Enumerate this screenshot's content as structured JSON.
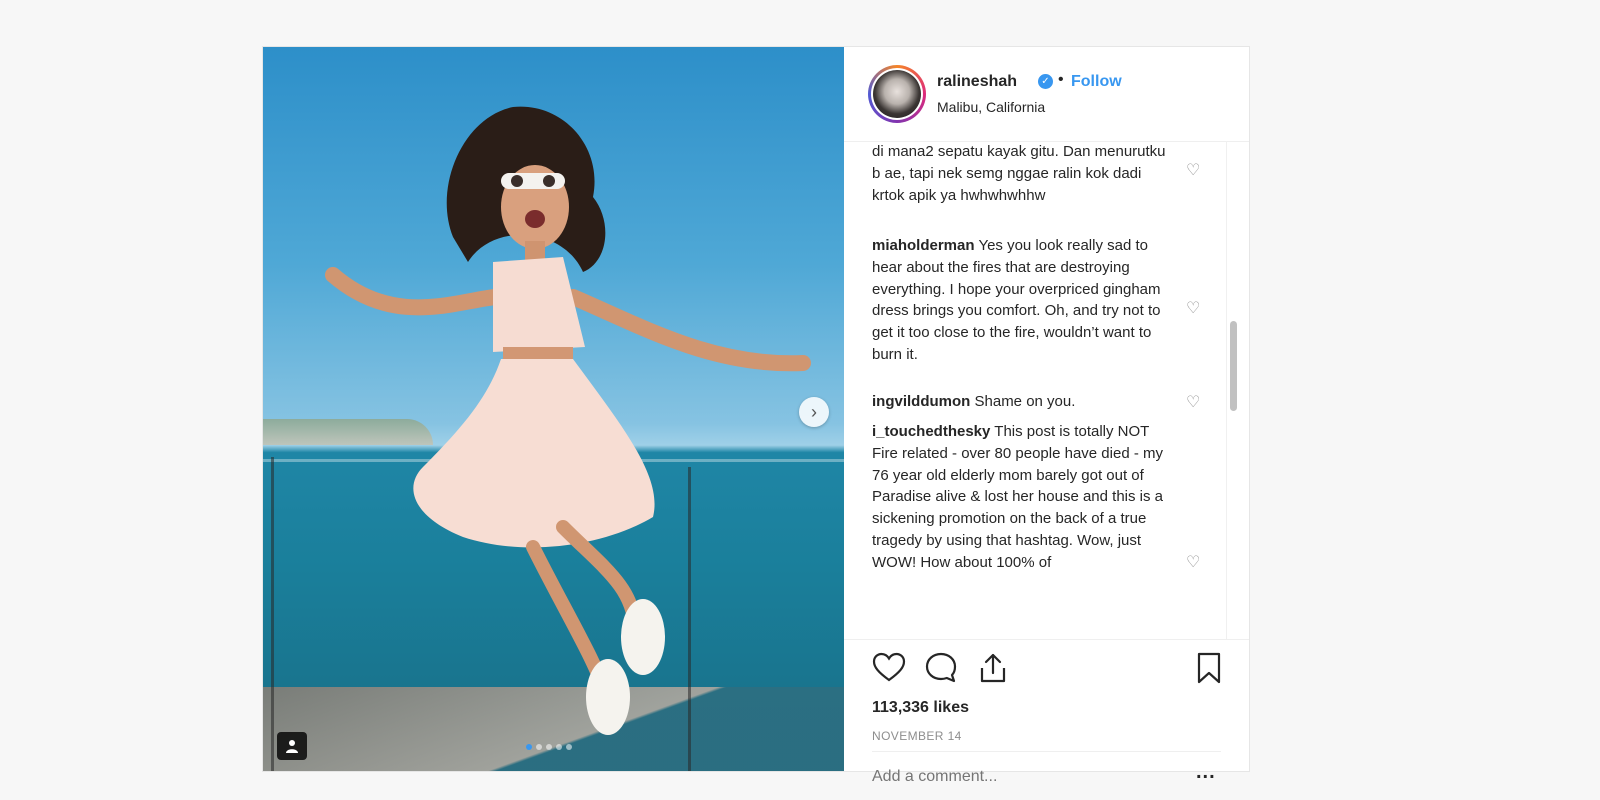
{
  "post": {
    "username": "ralineshah",
    "verified_icon": "verified-badge-icon",
    "separator": "•",
    "follow_label": "Follow",
    "location": "Malibu, California",
    "carousel": {
      "slide_count": 5,
      "active_index": 0
    },
    "comments": [
      {
        "text": "di mana2 sepatu kayak gitu. Dan menurutku b ae, tapi nek semg nggae ralin kok dadi krtok apik ya hwhwhwhhw"
      },
      {
        "user": "miaholderman",
        "text": "Yes you look really sad to hear about the fires that are destroying everything. I hope your overpriced gingham dress brings you comfort. Oh, and try not to get it too close to the fire, wouldn’t want to burn it."
      },
      {
        "user": "ingvilddumon",
        "text": "Shame on you."
      },
      {
        "user": "i_touchedthesky",
        "text": "This post is totally NOT Fire related - over 80 people have died - my 76 year old elderly mom barely got out of Paradise alive & lost her house and this is a sickening promotion on the back of a true tragedy by using that hashtag. Wow, just WOW! How about 100% of"
      }
    ],
    "likes": "113,336 likes",
    "date": "NOVEMBER 14",
    "add_comment_placeholder": "Add a comment...",
    "more_label": "..."
  },
  "colors": {
    "link_blue": "#3897f0",
    "text": "#262626",
    "muted": "#8e8e8e",
    "border": "#efefef",
    "background": "#f7f7f7"
  },
  "icons": [
    "chevron-right-icon",
    "user-tag-icon",
    "heart-icon",
    "comment-icon",
    "share-icon",
    "bookmark-icon",
    "verified-badge-icon"
  ]
}
